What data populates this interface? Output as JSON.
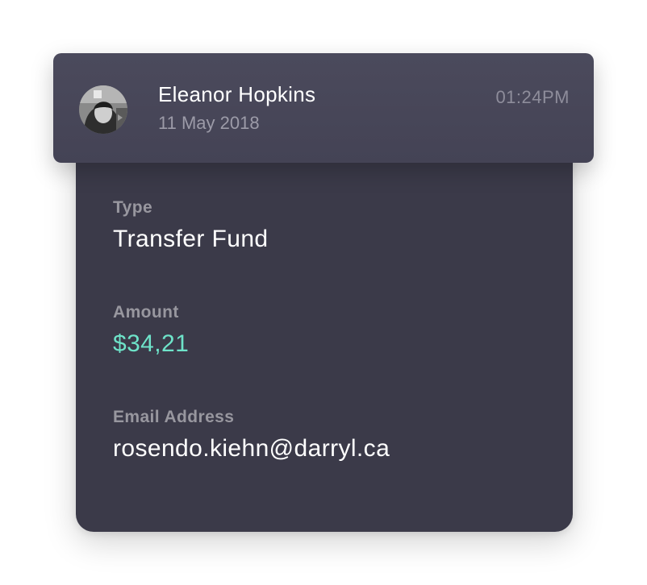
{
  "header": {
    "name": "Eleanor Hopkins",
    "date": "11 May 2018",
    "time": "01:24PM",
    "avatar_icon": "user-avatar"
  },
  "fields": {
    "type": {
      "label": "Type",
      "value": "Transfer Fund"
    },
    "amount": {
      "label": "Amount",
      "value": "$34,21"
    },
    "email": {
      "label": "Email Address",
      "value": "rosendo.kiehn@darryl.ca"
    }
  },
  "colors": {
    "card_bg": "#3b3a49",
    "header_bg": "#4a495b",
    "amount_accent": "#6ee3c9",
    "label": "#98979f"
  }
}
